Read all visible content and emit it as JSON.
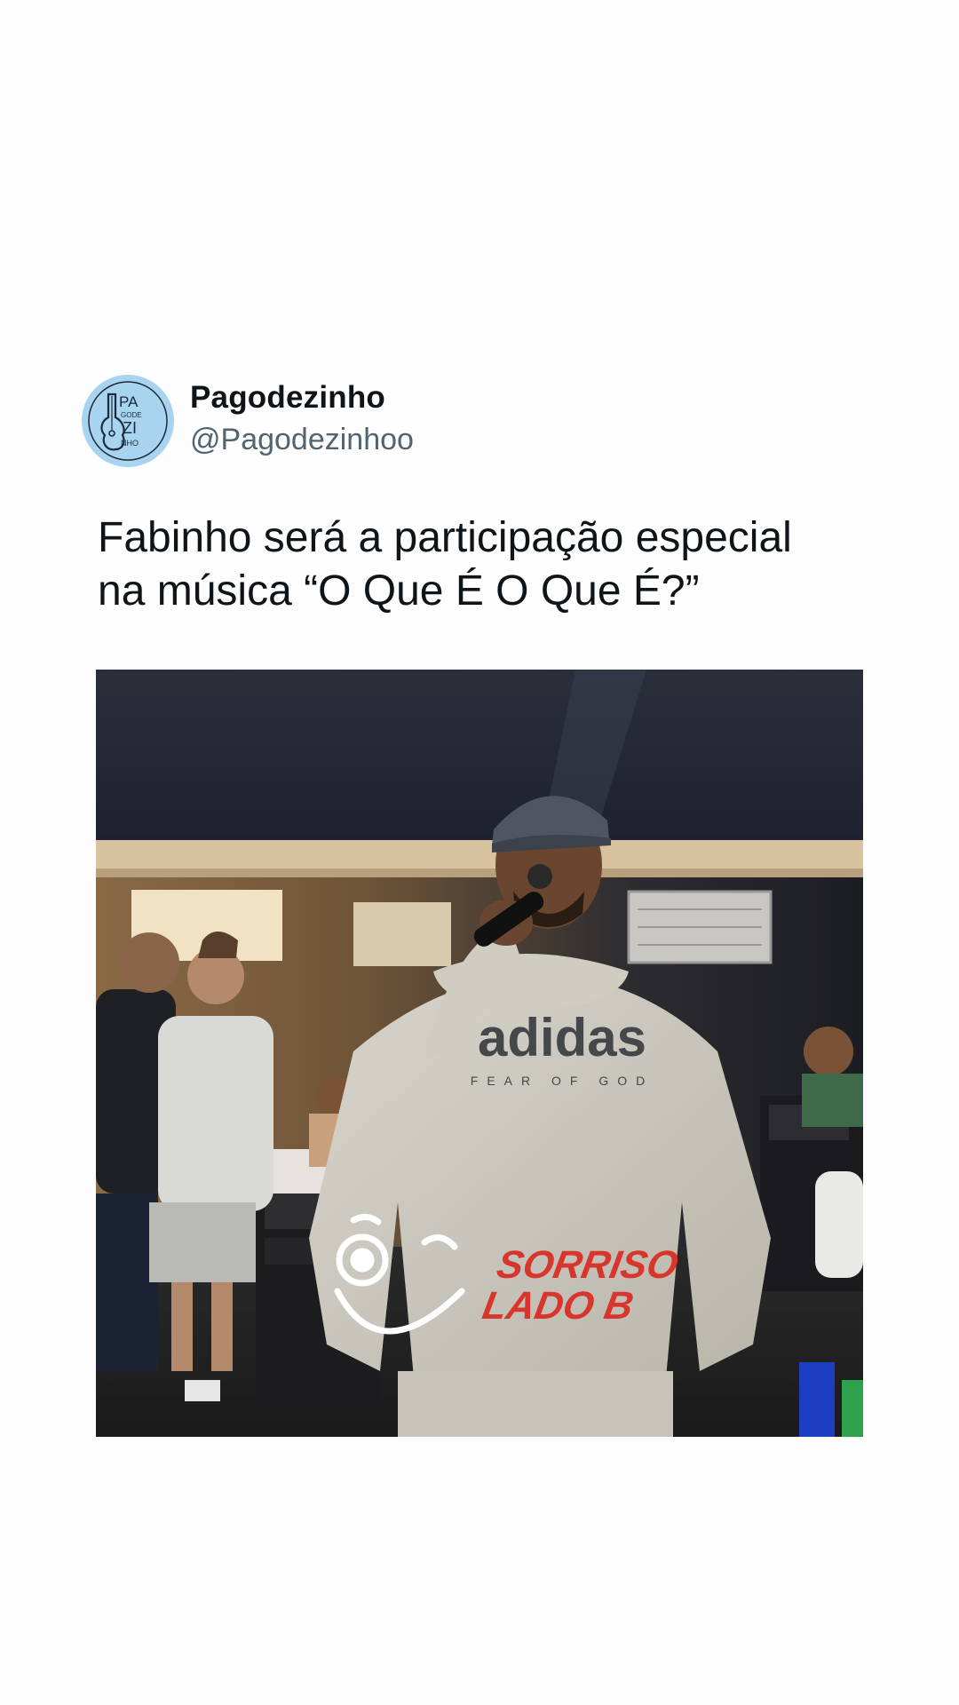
{
  "tweet": {
    "author": {
      "display_name": "Pagodezinho",
      "handle": "@Pagodezinhoo",
      "avatar_icon": "guitar-logo-icon",
      "avatar_logo_text": [
        "PA",
        "GODE",
        "ZI",
        "NHO"
      ],
      "avatar_color": "#a9d4ef"
    },
    "text_line_1": "Fabinho será a participação especial",
    "text_line_2": "na música “O Que É O Que É?”",
    "media": {
      "shirt_print": "adidas",
      "shirt_subprint": "FEAR OF GOD",
      "watermark_line_1": "SORRISO",
      "watermark_line_2": "LADO B",
      "watermark_color": "#d8362d"
    }
  }
}
